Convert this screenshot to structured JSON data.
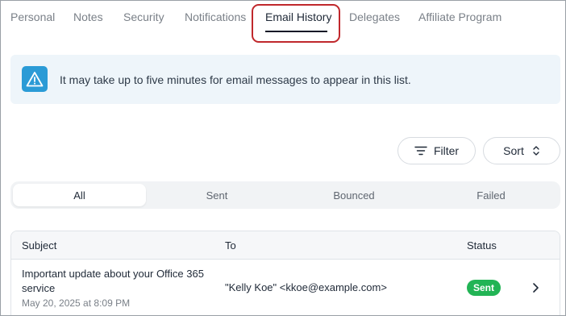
{
  "tabs": [
    {
      "label": "Personal"
    },
    {
      "label": "Notes"
    },
    {
      "label": "Security"
    },
    {
      "label": "Notifications"
    },
    {
      "label": "Email History",
      "active": true
    },
    {
      "label": "Delegates"
    },
    {
      "label": "Affiliate Program"
    }
  ],
  "alert": {
    "icon": "warning-icon",
    "message": "It may take up to five minutes for email messages to appear in this list."
  },
  "toolbar": {
    "filter_label": "Filter",
    "filter_icon": "filter-lines-icon",
    "sort_label": "Sort",
    "sort_icon": "chevron-up-down-icon"
  },
  "segments": [
    {
      "label": "All",
      "active": true
    },
    {
      "label": "Sent"
    },
    {
      "label": "Bounced"
    },
    {
      "label": "Failed"
    }
  ],
  "table": {
    "columns": [
      "Subject",
      "To",
      "Status"
    ],
    "rows": [
      {
        "subject": "Important update about your Office 365 service",
        "date": "May 20, 2025 at 8:09 PM",
        "to": "\"Kelly Koe\" <kkoe@example.com>",
        "status": "Sent"
      }
    ]
  },
  "colors": {
    "accent_info": "#2b9bd6",
    "status_sent": "#22b455",
    "highlight_outline": "#c0282c"
  }
}
